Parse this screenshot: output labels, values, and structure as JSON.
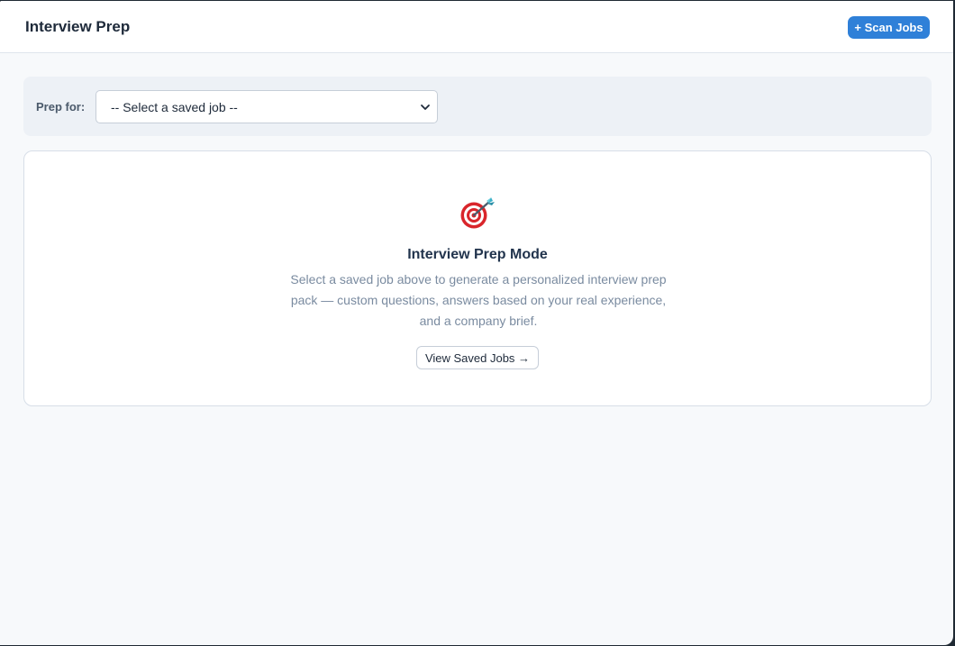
{
  "header": {
    "title": "Interview Prep",
    "scan_button": "+ Scan Jobs"
  },
  "prep": {
    "label": "Prep for:",
    "select_value": "-- Select a saved job --"
  },
  "empty_state": {
    "icon": "target-dart-icon",
    "title": "Interview Prep Mode",
    "description": "Select a saved job above to generate a personalized interview prep pack — custom questions, answers based on your real experience, and a company brief.",
    "button": "View Saved Jobs →"
  },
  "colors": {
    "accent": "#2f80d8",
    "background": "#f7f9fb",
    "prep_bar": "#edf1f6"
  }
}
